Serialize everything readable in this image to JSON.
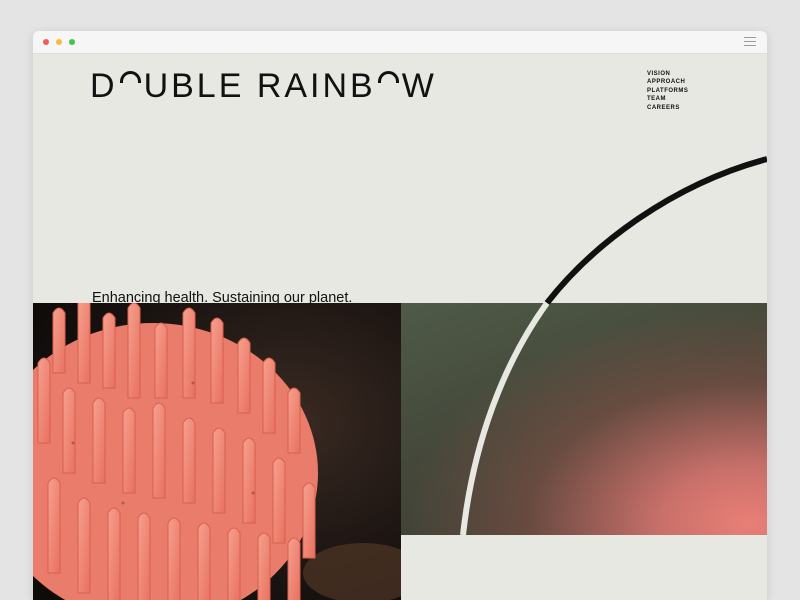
{
  "browser": {
    "traffic_lights": [
      "#ee5e57",
      "#f6bd3b",
      "#3fc84f"
    ]
  },
  "header": {
    "logo_left": "D",
    "logo_mid": "UBLE RAINB",
    "logo_right": "W"
  },
  "nav": {
    "items": [
      "VISION",
      "APPROACH",
      "PLATFORMS",
      "TEAM",
      "CAREERS"
    ]
  },
  "hero": {
    "tagline": "Enhancing health. Sustaining our planet."
  },
  "colors": {
    "background": "#e8e8e3",
    "text": "#111111",
    "coral": "#f08a7a",
    "dark_green": "#4f5a47"
  },
  "images": {
    "left": "coral-fungus-photo",
    "right": "green-to-pink-gradient"
  }
}
